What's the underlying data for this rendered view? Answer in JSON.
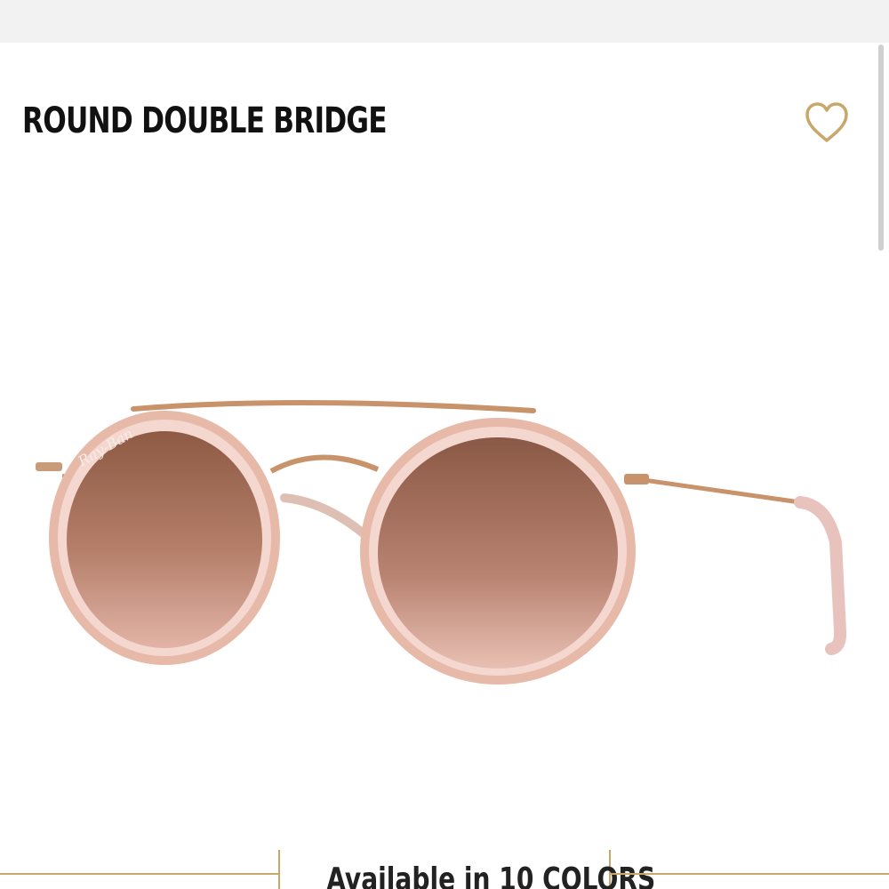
{
  "product": {
    "title": "ROUND DOUBLE BRIDGE",
    "brand_mark": "Ray-Ban",
    "image_icon": "sunglasses-product-image"
  },
  "wishlist": {
    "icon": "heart-icon"
  },
  "colors": {
    "available_text": "Available in 10 COLORS"
  },
  "theme": {
    "accent": "#c7a86a",
    "title_color": "#111111",
    "header_bg": "#f2f2f2"
  }
}
